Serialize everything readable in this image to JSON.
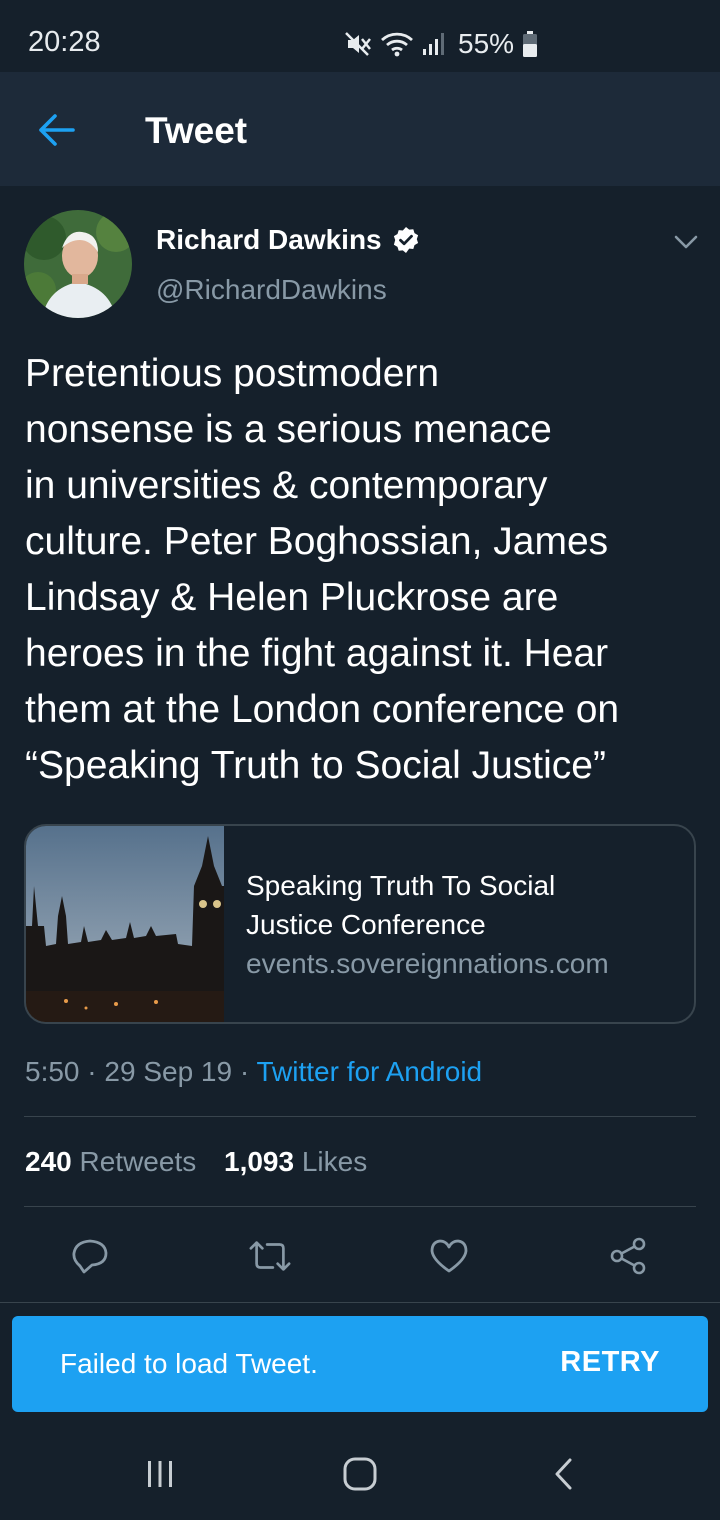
{
  "status_bar": {
    "time": "20:28",
    "battery": "55%",
    "icons": [
      "mute-icon",
      "wifi-icon",
      "signal-icon",
      "battery-icon"
    ]
  },
  "app_bar": {
    "title": "Tweet",
    "back_icon": "arrow-left-icon"
  },
  "tweet": {
    "author_name": "Richard Dawkins",
    "verified": true,
    "handle": "@RichardDawkins",
    "text_lines": [
      "Pretentious postmodern",
      "nonsense is a serious menace",
      "in universities & contemporary",
      "culture. Peter Boghossian, James",
      "Lindsay & Helen Pluckrose are",
      "heroes in the fight against it. Hear",
      "them at the London conference on",
      "“Speaking Truth to Social Justice”"
    ],
    "card": {
      "title_lines": [
        "Speaking Truth To Social",
        "Justice Conference"
      ],
      "domain": "events.sovereignnations.com"
    },
    "time": "5:50",
    "separator": " · ",
    "date": "29 Sep 19",
    "source": "Twitter for Android",
    "retweets_count": "240",
    "retweets_label": "Retweets",
    "likes_count": "1,093",
    "likes_label": "Likes"
  },
  "actions": [
    "reply-icon",
    "retweet-icon",
    "like-icon",
    "share-icon"
  ],
  "snackbar": {
    "message": "Failed to load Tweet.",
    "action_label": "RETRY"
  },
  "colors": {
    "background": "#15202b",
    "app_bar": "#1d2a39",
    "accent": "#1da1f2",
    "secondary_text": "#8899a6",
    "divider": "#38444d"
  }
}
